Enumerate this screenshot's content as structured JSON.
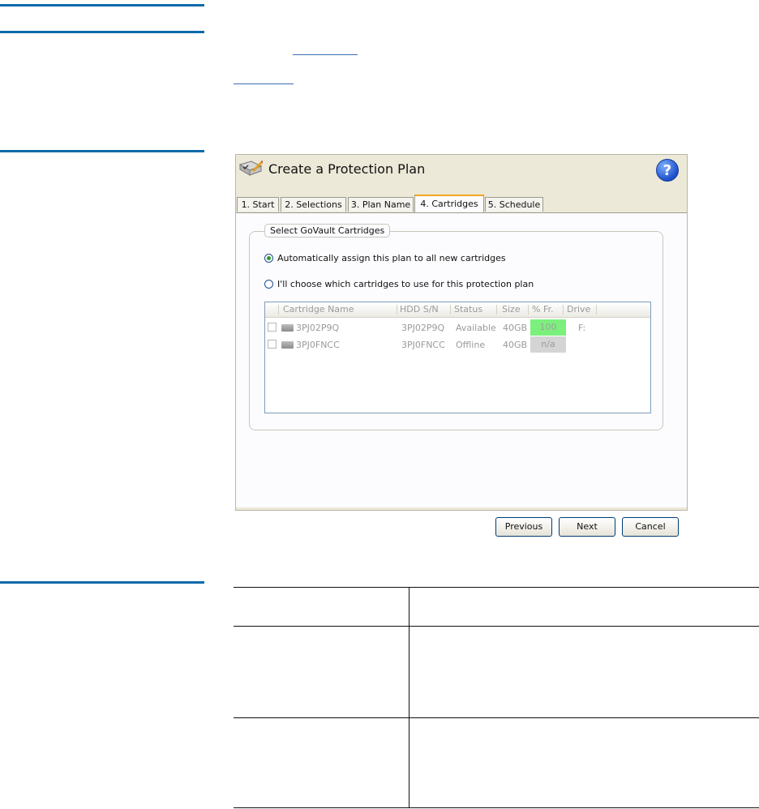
{
  "dialog": {
    "title": "Create a Protection Plan",
    "help_icon": "help-icon",
    "tabs": [
      {
        "label": "1. Start"
      },
      {
        "label": "2. Selections"
      },
      {
        "label": "3. Plan Name"
      },
      {
        "label": "4. Cartridges",
        "active": true
      },
      {
        "label": "5. Schedule"
      }
    ],
    "group_label": "Select GoVault Cartridges",
    "radio_auto": "Automatically assign this plan to all new cartridges",
    "radio_manual": "I'll choose which cartridges to use for this protection plan",
    "grid": {
      "columns": [
        "Cartridge Name",
        "HDD S/N",
        "Status",
        "Size",
        "% Fr.",
        "Drive"
      ],
      "rows": [
        {
          "name": "3PJ02P9Q",
          "sn": "3PJ02P9Q",
          "status": "Available",
          "size": "40GB",
          "free": "100",
          "drive": "F:"
        },
        {
          "name": "3PJ0FNCC",
          "sn": "3PJ0FNCC",
          "status": "Offline",
          "size": "40GB",
          "free": "n/a",
          "drive": ""
        }
      ]
    },
    "buttons": {
      "previous": "Previous",
      "next": "Next",
      "cancel": "Cancel"
    }
  },
  "colors": {
    "accent_rule": "#0a6aa8",
    "free_ok": "#7cf07c",
    "free_na": "#d4d4d4"
  }
}
